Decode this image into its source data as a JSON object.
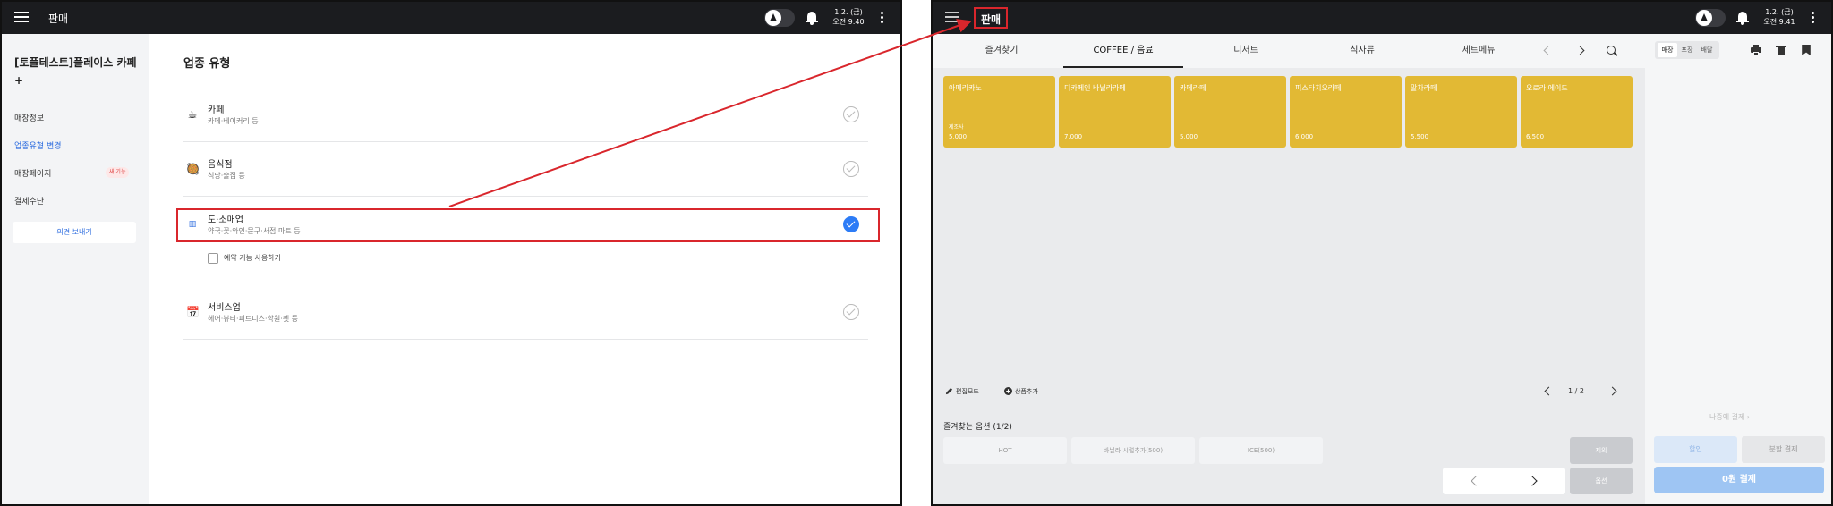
{
  "left_screen": {
    "topbar": {
      "title": "판매",
      "date": "1.2. (금)",
      "time": "오전 9:40"
    },
    "sidebar": {
      "store_name": "[토플테스트]플레이스 카페+",
      "items": [
        {
          "label": "매장정보"
        },
        {
          "label": "업종유형 변경"
        },
        {
          "label": "매장페이지",
          "badge": "새 기능"
        },
        {
          "label": "결제수단"
        }
      ],
      "feedback_button": "의견 보내기"
    },
    "content": {
      "title": "업종 유형",
      "types": [
        {
          "name": "카페",
          "desc": "카페·베이커리 등",
          "icon": "coffee-icon",
          "selected": false
        },
        {
          "name": "음식점",
          "desc": "식당·술집 등",
          "icon": "food-icon",
          "selected": false
        },
        {
          "name": "도·소매업",
          "desc": "약국·꽃·와인·문구·서점·마트 등",
          "icon": "barcode-icon",
          "selected": true
        },
        {
          "name": "서비스업",
          "desc": "헤어·뷰티·피트니스·학원·펫 등",
          "icon": "calendar-icon",
          "selected": false
        }
      ],
      "reservation_option": "예약 기능 사용하기"
    }
  },
  "right_screen": {
    "topbar": {
      "title": "판매",
      "date": "1.2. (금)",
      "time": "오전 9:41"
    },
    "tabs": [
      "즐겨찾기",
      "COFFEE / 음료",
      "디저트",
      "식사류",
      "세트메뉴"
    ],
    "active_tab": "COFFEE / 음료",
    "products": [
      {
        "name": "아메리카노",
        "price": "5,000",
        "sub": "제조사"
      },
      {
        "name": "디카페인 바닐라라떼",
        "price": "7,000"
      },
      {
        "name": "카페라떼",
        "price": "5,000"
      },
      {
        "name": "피스타치오라떼",
        "price": "6,000"
      },
      {
        "name": "말차라떼",
        "price": "5,500"
      },
      {
        "name": "오로라 에이드",
        "price": "6,500"
      }
    ],
    "toolbar": {
      "edit_mode": "편집모드",
      "add_product": "상품추가",
      "page": "1 / 2"
    },
    "favorite_options": {
      "title": "즐겨찾는 옵션 (1/2)",
      "options": [
        "HOT",
        "바닐라 시럽추가(500)",
        "ICE(500)"
      ],
      "remove_label": "제외",
      "option_label": "옵션"
    },
    "cart": {
      "order_types": [
        "매장",
        "포장",
        "배달"
      ],
      "active_order_type": "매장",
      "pay_later": "나중에 결제 ›",
      "discount": "할인",
      "split_pay": "분할 결제",
      "pay": "0원 결제"
    }
  },
  "colors": {
    "topbar": "#1b1c1f",
    "accent_blue": "#2d7cf6",
    "annotation_red": "#d9262c",
    "product_tile": "#e2b934"
  }
}
